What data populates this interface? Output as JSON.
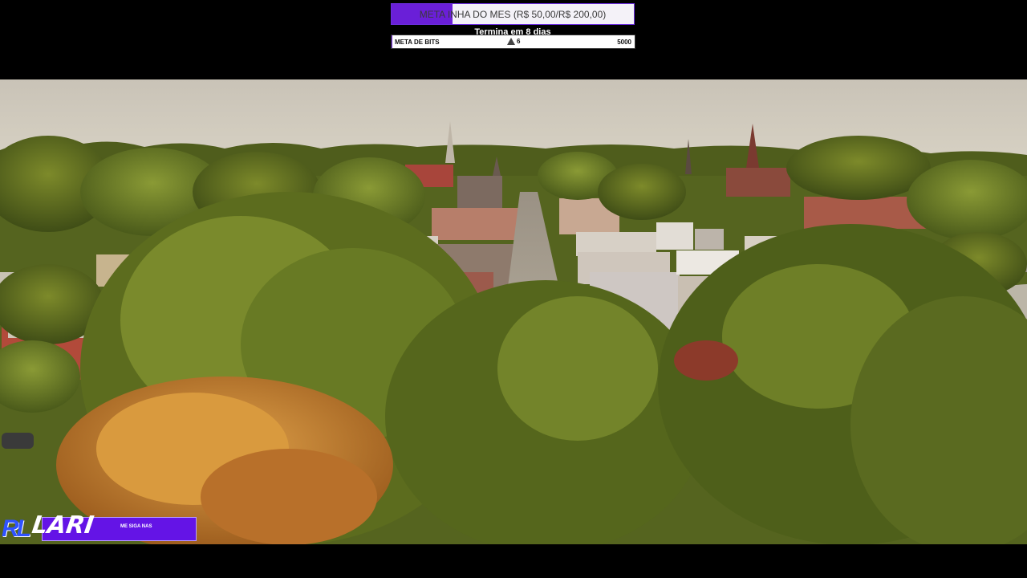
{
  "overlay": {
    "subgoal": {
      "label": "META INHA DO MES (R$ 50,00/R$ 200,00)",
      "progress": 0.25,
      "accent": "#6a1fd8"
    },
    "countdown": "Termina em 8 dias",
    "bits_goal": {
      "label": "META DE BITS",
      "current": "6",
      "max": "5000",
      "icon": "bits-icon",
      "progress": 0.0012
    }
  },
  "brand": {
    "logo_text": "RL",
    "name": "LARI",
    "tagline": "ME SIGA NAS",
    "accent": "#6414e6"
  }
}
